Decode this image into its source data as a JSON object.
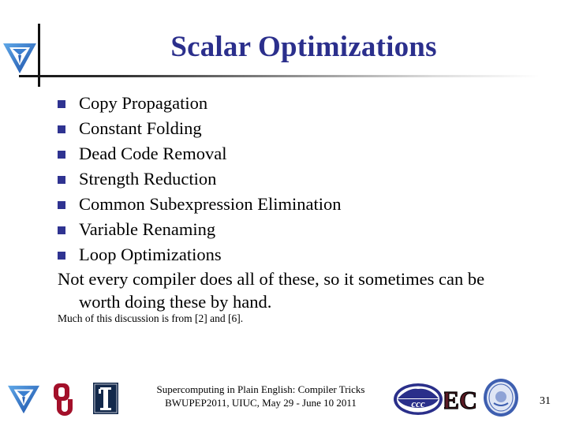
{
  "slide": {
    "title": "Scalar Optimizations",
    "bullets": [
      "Copy Propagation",
      "Constant Folding",
      "Dead Code Removal",
      "Strength Reduction",
      "Common Subexpression Elimination",
      "Variable Renaming",
      "Loop Optimizations"
    ],
    "note_line1": "Not every compiler does all of these, so it sometimes can be",
    "note_line2": "worth doing these by hand.",
    "reference": "Much of this discussion is from [2] and [6].",
    "colors": {
      "title": "#2b2f8c",
      "bullet": "#2f3391"
    }
  },
  "footer": {
    "line1": "Supercomputing in Plain English: Compiler Tricks",
    "line2": "BWUPEP2011, UIUC, May 29 - June 10 2011",
    "page_number": "31",
    "logos": [
      "oscer-triangle-logo",
      "ou-logo",
      "illinois-logo",
      "ccc-logo",
      "ec-logo",
      "seal-logo"
    ],
    "ou_text": "OU",
    "ec_text": "EC",
    "ccc_text": "ccc"
  }
}
